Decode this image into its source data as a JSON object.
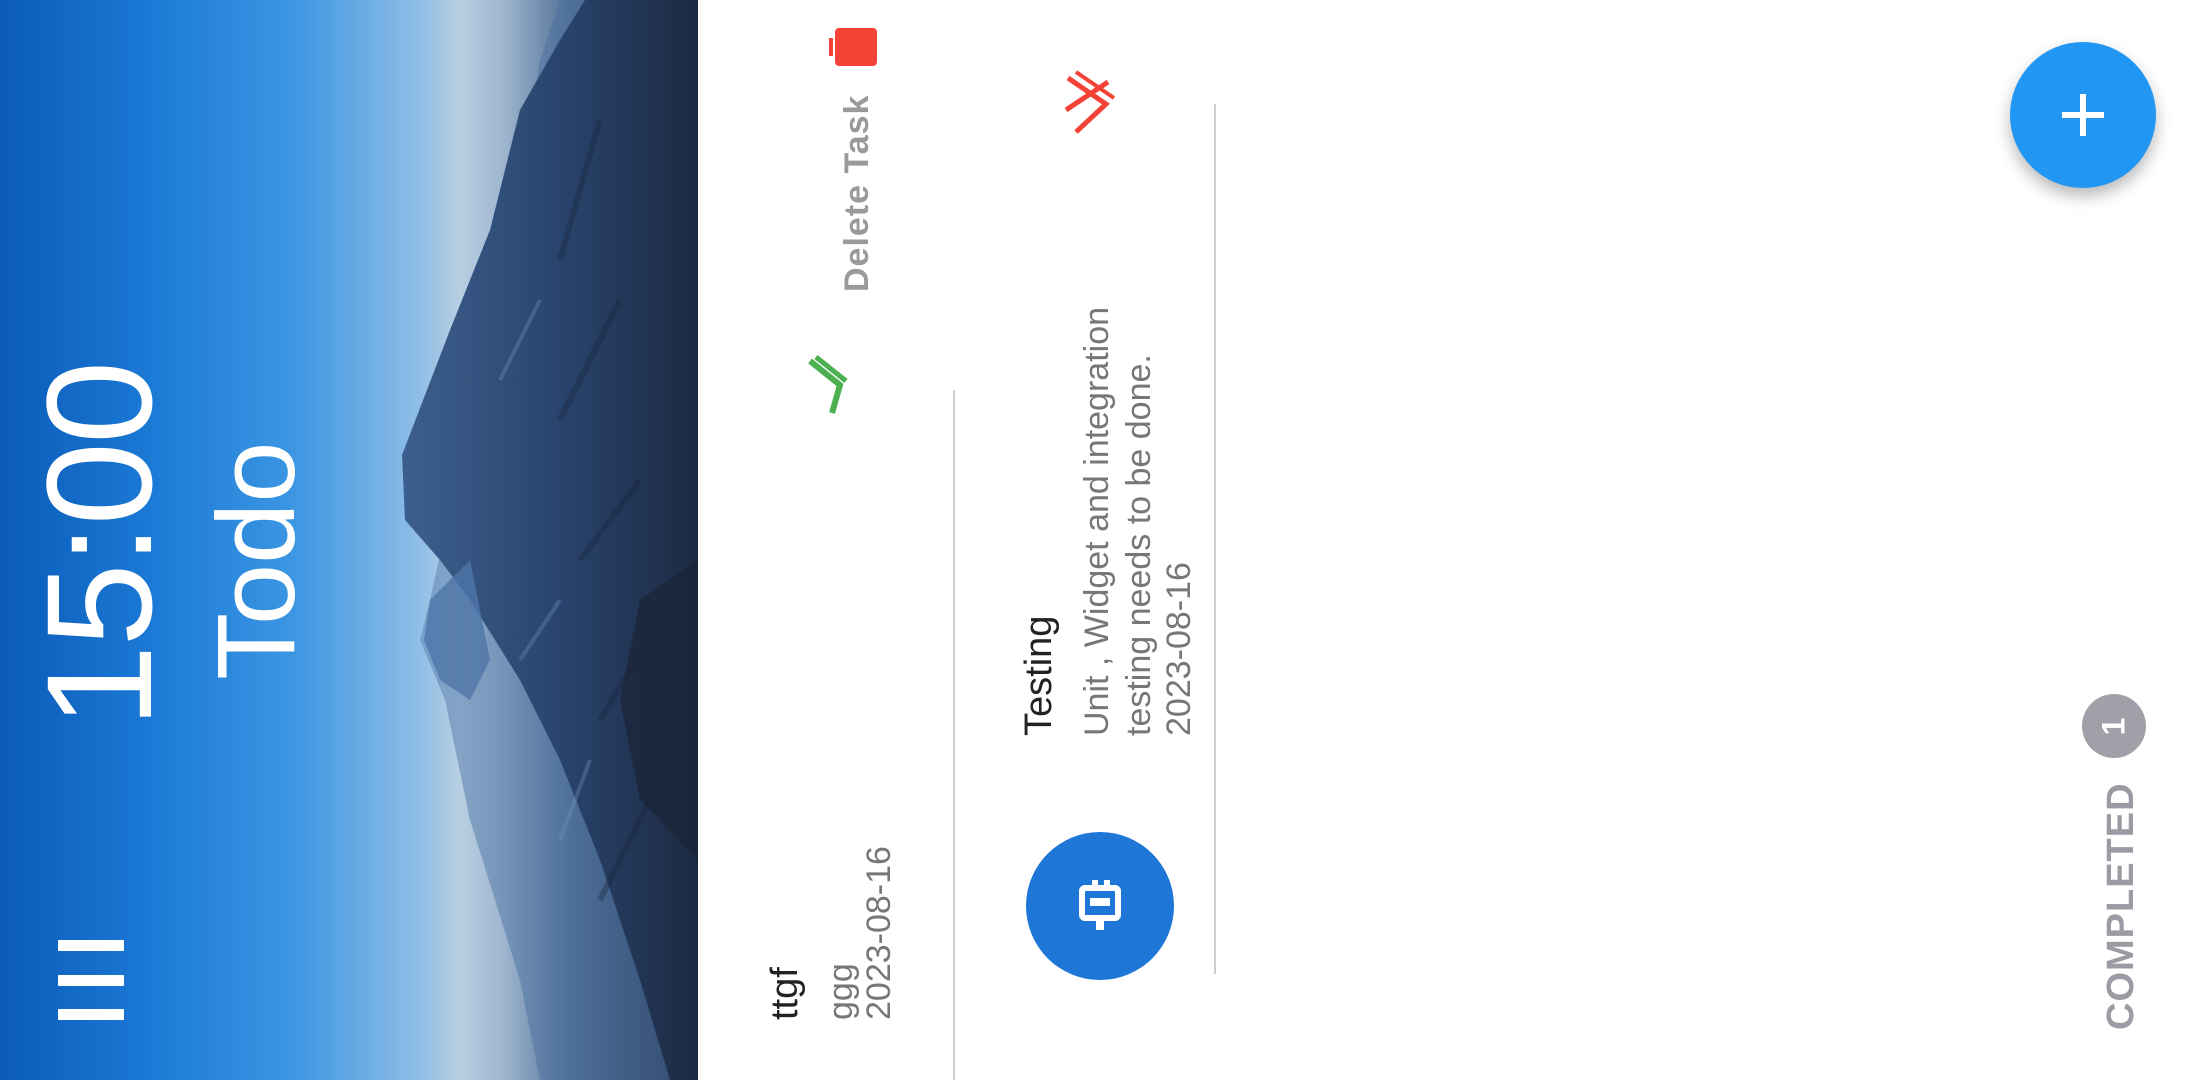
{
  "header": {
    "time": "15:00",
    "title": "Todo"
  },
  "tasks": [
    {
      "title": "ttgf",
      "description": "ggg",
      "date": "2023-08-16",
      "swipe_action_label": "Delete Task"
    },
    {
      "title": "Testing",
      "description_lines": [
        "Unit , Widget and integration",
        "testing needs to be done."
      ],
      "date": "2023-08-16"
    }
  ],
  "completed": {
    "label": "COMPLETED",
    "count": "1"
  },
  "colors": {
    "accent": "#2196f3",
    "avatar": "#1e76d6",
    "delete": "#f44336",
    "check": "#4caf50",
    "badge": "#a0a0a8"
  },
  "icons": {
    "menu": "menu-icon",
    "task_avatar": "task-category-icon",
    "check": "check-icon",
    "delete": "trash-icon",
    "cancel": "cancel-icon",
    "add": "plus-icon"
  }
}
